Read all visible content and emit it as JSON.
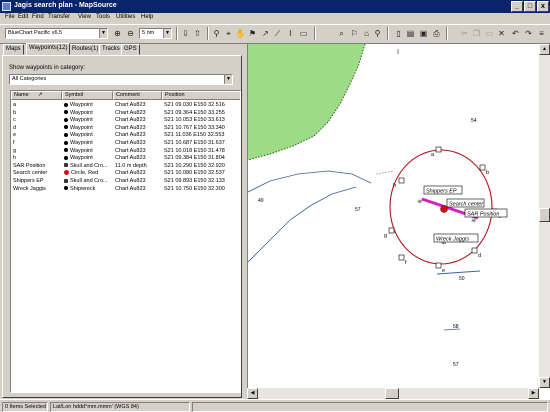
{
  "window": {
    "title": "Jagis search plan - MapSource",
    "minimize": "_",
    "maximize": "□",
    "close": "x"
  },
  "menu": [
    "File",
    "Edit",
    "Find",
    "Transfer",
    "View",
    "Tools",
    "Utilities",
    "Help"
  ],
  "toolbar": {
    "product_select": "BlueChart Pacific v6.5",
    "scale_select": "5 nm"
  },
  "tabs": [
    "Maps",
    "Waypoints(12)",
    "Routes(1)",
    "Tracks",
    "GPS"
  ],
  "waypoints_panel": {
    "category_label": "Show waypoints in category:",
    "category_value": "All Categories",
    "columns": [
      "Name",
      "Symbol",
      "Comment",
      "Position"
    ],
    "rows": [
      {
        "name": "a",
        "symbol": "Waypoint",
        "comment": "Chart Au823",
        "position": "S21 09.030 E150 32.516"
      },
      {
        "name": "b",
        "symbol": "Waypoint",
        "comment": "Chart Au823",
        "position": "S21 09.364 E150 33.255"
      },
      {
        "name": "c",
        "symbol": "Waypoint",
        "comment": "Chart Au823",
        "position": "S21 10.053 E150 33.613"
      },
      {
        "name": "d",
        "symbol": "Waypoint",
        "comment": "Chart Au823",
        "position": "S21 10.767 E150 33.340"
      },
      {
        "name": "e",
        "symbol": "Waypoint",
        "comment": "Chart Au823",
        "position": "S21 11.036 E150 32.553"
      },
      {
        "name": "f",
        "symbol": "Waypoint",
        "comment": "Chart Au823",
        "position": "S21 10.687 E150 31.637"
      },
      {
        "name": "g",
        "symbol": "Waypoint",
        "comment": "Chart Au823",
        "position": "S21 10.018 E150 31.478"
      },
      {
        "name": "h",
        "symbol": "Waypoint",
        "comment": "Chart Au823",
        "position": "S21 09.384 E150 31.804"
      },
      {
        "name": "SAR Position",
        "symbol": "Skull and Cro...",
        "comment": "11.0 m depth",
        "position": "S21 10.290 E150 32.920"
      },
      {
        "name": "Search center",
        "symbol": "Circle, Red",
        "comment": "Chart Au823",
        "position": "S21 10.080 E150 32.537"
      },
      {
        "name": "Shippers EP",
        "symbol": "Skull and Cro...",
        "comment": "Chart Au823",
        "position": "S21 09.893 E150 32.133"
      },
      {
        "name": "Wreck Jaggis",
        "symbol": "Shipwreck",
        "comment": "Chart Au823",
        "position": "S21 10.750 E150 32.300"
      }
    ]
  },
  "map": {
    "labels": {
      "shippers_ep": "Shippers EP",
      "search_center": "Search center",
      "sar_position": "SAR Position",
      "wreck_jaggis": "Wreck Jaggis"
    },
    "waypoint_letters": [
      "a",
      "b",
      "c",
      "d",
      "e",
      "f",
      "g",
      "h"
    ],
    "soundings": [
      "54",
      "57",
      "49",
      "50",
      "58",
      "57"
    ],
    "colors": {
      "land": "#9ddb86",
      "circle": "#b01818",
      "track": "#d020c0",
      "depth_line": "#4060a0"
    }
  },
  "status": {
    "selection": "0 Items Selected",
    "format": "Lat/Lon hddd°mm.mmm' (WGS 84)"
  }
}
